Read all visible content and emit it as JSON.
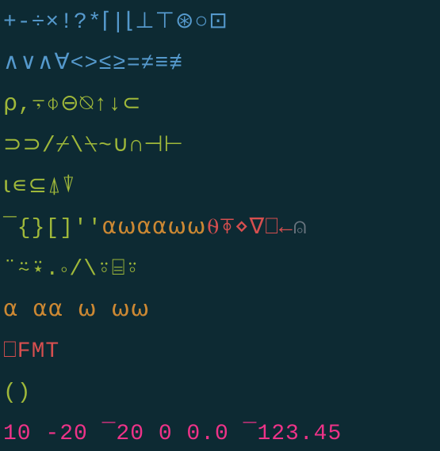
{
  "lines": [
    {
      "segments": [
        {
          "class": "blue",
          "text": "+-÷×!?*⌈|⌊⊥⊤⊛○⊡"
        }
      ]
    },
    {
      "segments": [
        {
          "class": "blue",
          "text": "∧∨∧∀<>≤≥=≠≡≢"
        }
      ]
    },
    {
      "segments": [
        {
          "class": "green",
          "text": "⍴,⍪⌽⊖⍉↑↓⊂"
        }
      ]
    },
    {
      "segments": [
        {
          "class": "green",
          "text": "⊃⊃/⌿\\⍀~∪∩⊣⊢"
        }
      ]
    },
    {
      "segments": [
        {
          "class": "green",
          "text": "⍳∊⊆⍋⍒"
        }
      ]
    },
    {
      "segments": [
        {
          "class": "green",
          "text": "¯{}[]''"
        },
        {
          "class": "orange",
          "text": "⍺⍵⍺⍺⍵⍵"
        },
        {
          "class": "red",
          "text": "⍬⍕⋄∇⎕←"
        },
        {
          "class": "grey",
          "text": "⍝"
        }
      ]
    },
    {
      "segments": [
        {
          "class": "green",
          "text": "¨⍨⍣.∘/\\⍤⌸⍤"
        }
      ]
    },
    {
      "segments": [
        {
          "class": "orange",
          "text": "⍺ ⍺⍺ ⍵ ⍵⍵"
        }
      ]
    },
    {
      "segments": [
        {
          "class": "red",
          "text": "⎕FMT"
        }
      ]
    },
    {
      "segments": [
        {
          "class": "green",
          "text": "()"
        }
      ]
    },
    {
      "segments": [
        {
          "class": "pink",
          "text": "10 -20 ¯20 0 0.0 ¯123.45"
        }
      ]
    }
  ]
}
